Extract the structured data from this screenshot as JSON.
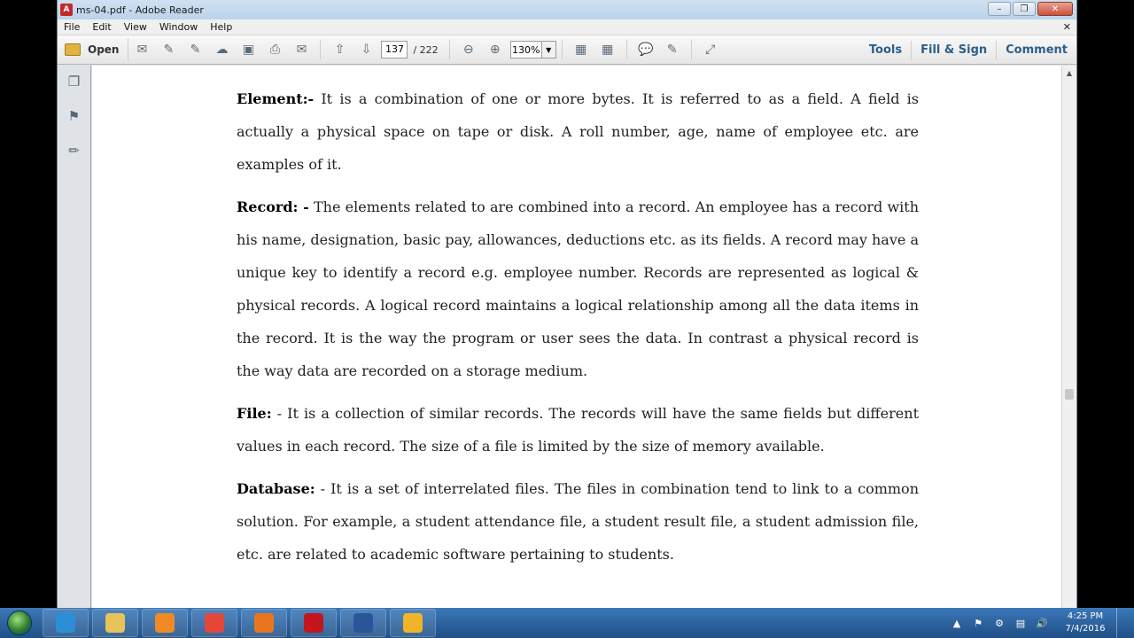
{
  "window": {
    "title": "ms-04.pdf - Adobe Reader",
    "app_icon_glyph": "A",
    "controls": [
      "–",
      "❐",
      "✕"
    ]
  },
  "menu": {
    "items": [
      "File",
      "Edit",
      "View",
      "Window",
      "Help"
    ],
    "close_glyph": "✕"
  },
  "toolbar": {
    "open_label": "Open",
    "page_current": "137",
    "page_total": "/ 222",
    "zoom": "130%",
    "tools_label": "Tools",
    "fill_sign_label": "Fill & Sign",
    "comment_label": "Comment"
  },
  "document": {
    "p1_head": "Element:-",
    "p1_body": " It is a combination of one or more bytes. It is referred to as a field. A field is actually a physical space on tape or disk. A roll number, age, name of employee etc. are examples of it.",
    "p2_head": "Record: -",
    "p2_body": " The elements related to are combined into a record. An employee has a record with his name, designation, basic pay, allowances, deductions etc. as its fields. A record may have a unique key to identify a record e.g. employee number. Records are represented as logical & physical records. A logical record maintains a logical relationship among all the data items in the record. It is the way the program or user sees the data. In contrast a physical record is the way data are recorded on a storage medium.",
    "p3_head": "File:",
    "p3_body": " - It is a collection of similar records. The records will have the same fields but different values in each record. The size of a file is limited by the size of memory available.",
    "p4_head": "Database:",
    "p4_body": " - It is a set of interrelated files. The files in combination tend to link to a common solution. For example, a student attendance file, a student result file, a student admission file, etc. are related to academic software pertaining to students."
  },
  "taskbar": {
    "time": "4:25 PM",
    "date": "7/4/2016",
    "apps": [
      "internet-explorer",
      "file-explorer",
      "media-player",
      "chrome",
      "firefox",
      "adobe-reader",
      "word",
      "flower-app"
    ],
    "app_colors": [
      "#2c8fd6",
      "#e8c35a",
      "#f08a24",
      "#e5463a",
      "#e9761e",
      "#c4161c",
      "#2a5699",
      "#f0b429"
    ]
  }
}
